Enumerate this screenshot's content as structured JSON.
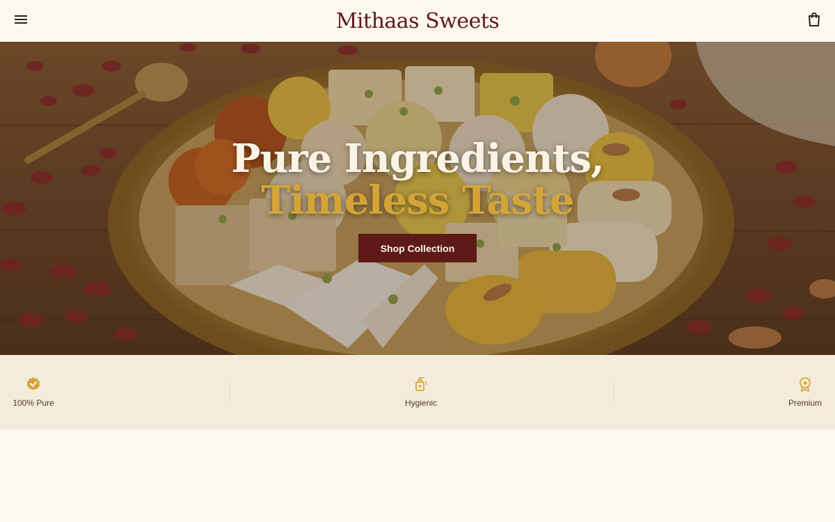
{
  "header": {
    "brand": "Mithaas Sweets",
    "menu_icon": "hamburger-menu-icon",
    "cart_icon": "shopping-bag-icon"
  },
  "hero": {
    "line1": "Pure Ingredients,",
    "line2": "Timeless Taste",
    "cta_label": "Shop Collection"
  },
  "features": [
    {
      "label": "100% Pure",
      "icon": "verified-badge-icon"
    },
    {
      "label": "Hygienic",
      "icon": "sanitizer-bottle-icon"
    },
    {
      "label": "Premium",
      "icon": "award-ribbon-icon"
    }
  ],
  "colors": {
    "brand": "#5e1a17",
    "accent_gold": "#d5a437",
    "background": "#fdf8ee",
    "feature_strip": "#f4ebdc"
  }
}
